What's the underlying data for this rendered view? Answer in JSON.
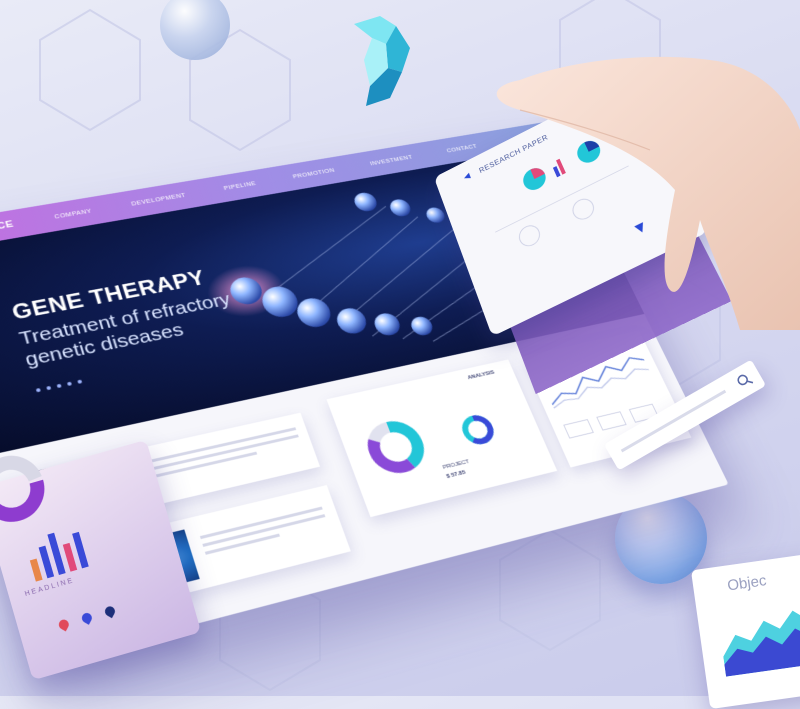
{
  "nav": {
    "brand": "IO SCIENCE",
    "items": [
      "COMPANY",
      "DEVELOPMENT",
      "PIPELINE",
      "PROMOTION",
      "INVESTMENT",
      "CONTACT"
    ]
  },
  "hero": {
    "title": "GENE THERAPY",
    "subtitle": "Treatment of refractory genetic diseases"
  },
  "phone": {
    "title": "RESEARCH PAPER"
  },
  "cards": {
    "analysis_label": "ANALYSIS",
    "project_label": "PROJECT",
    "project_value": "$ 57.85"
  },
  "left_card": {
    "headline": "HEADLINE"
  },
  "chart_card": {
    "title": "Objec"
  },
  "colors": {
    "accent_purple": "#a06ad9",
    "accent_blue": "#2a4ad6",
    "teal": "#22c6d8",
    "navy": "#0e1c52"
  }
}
